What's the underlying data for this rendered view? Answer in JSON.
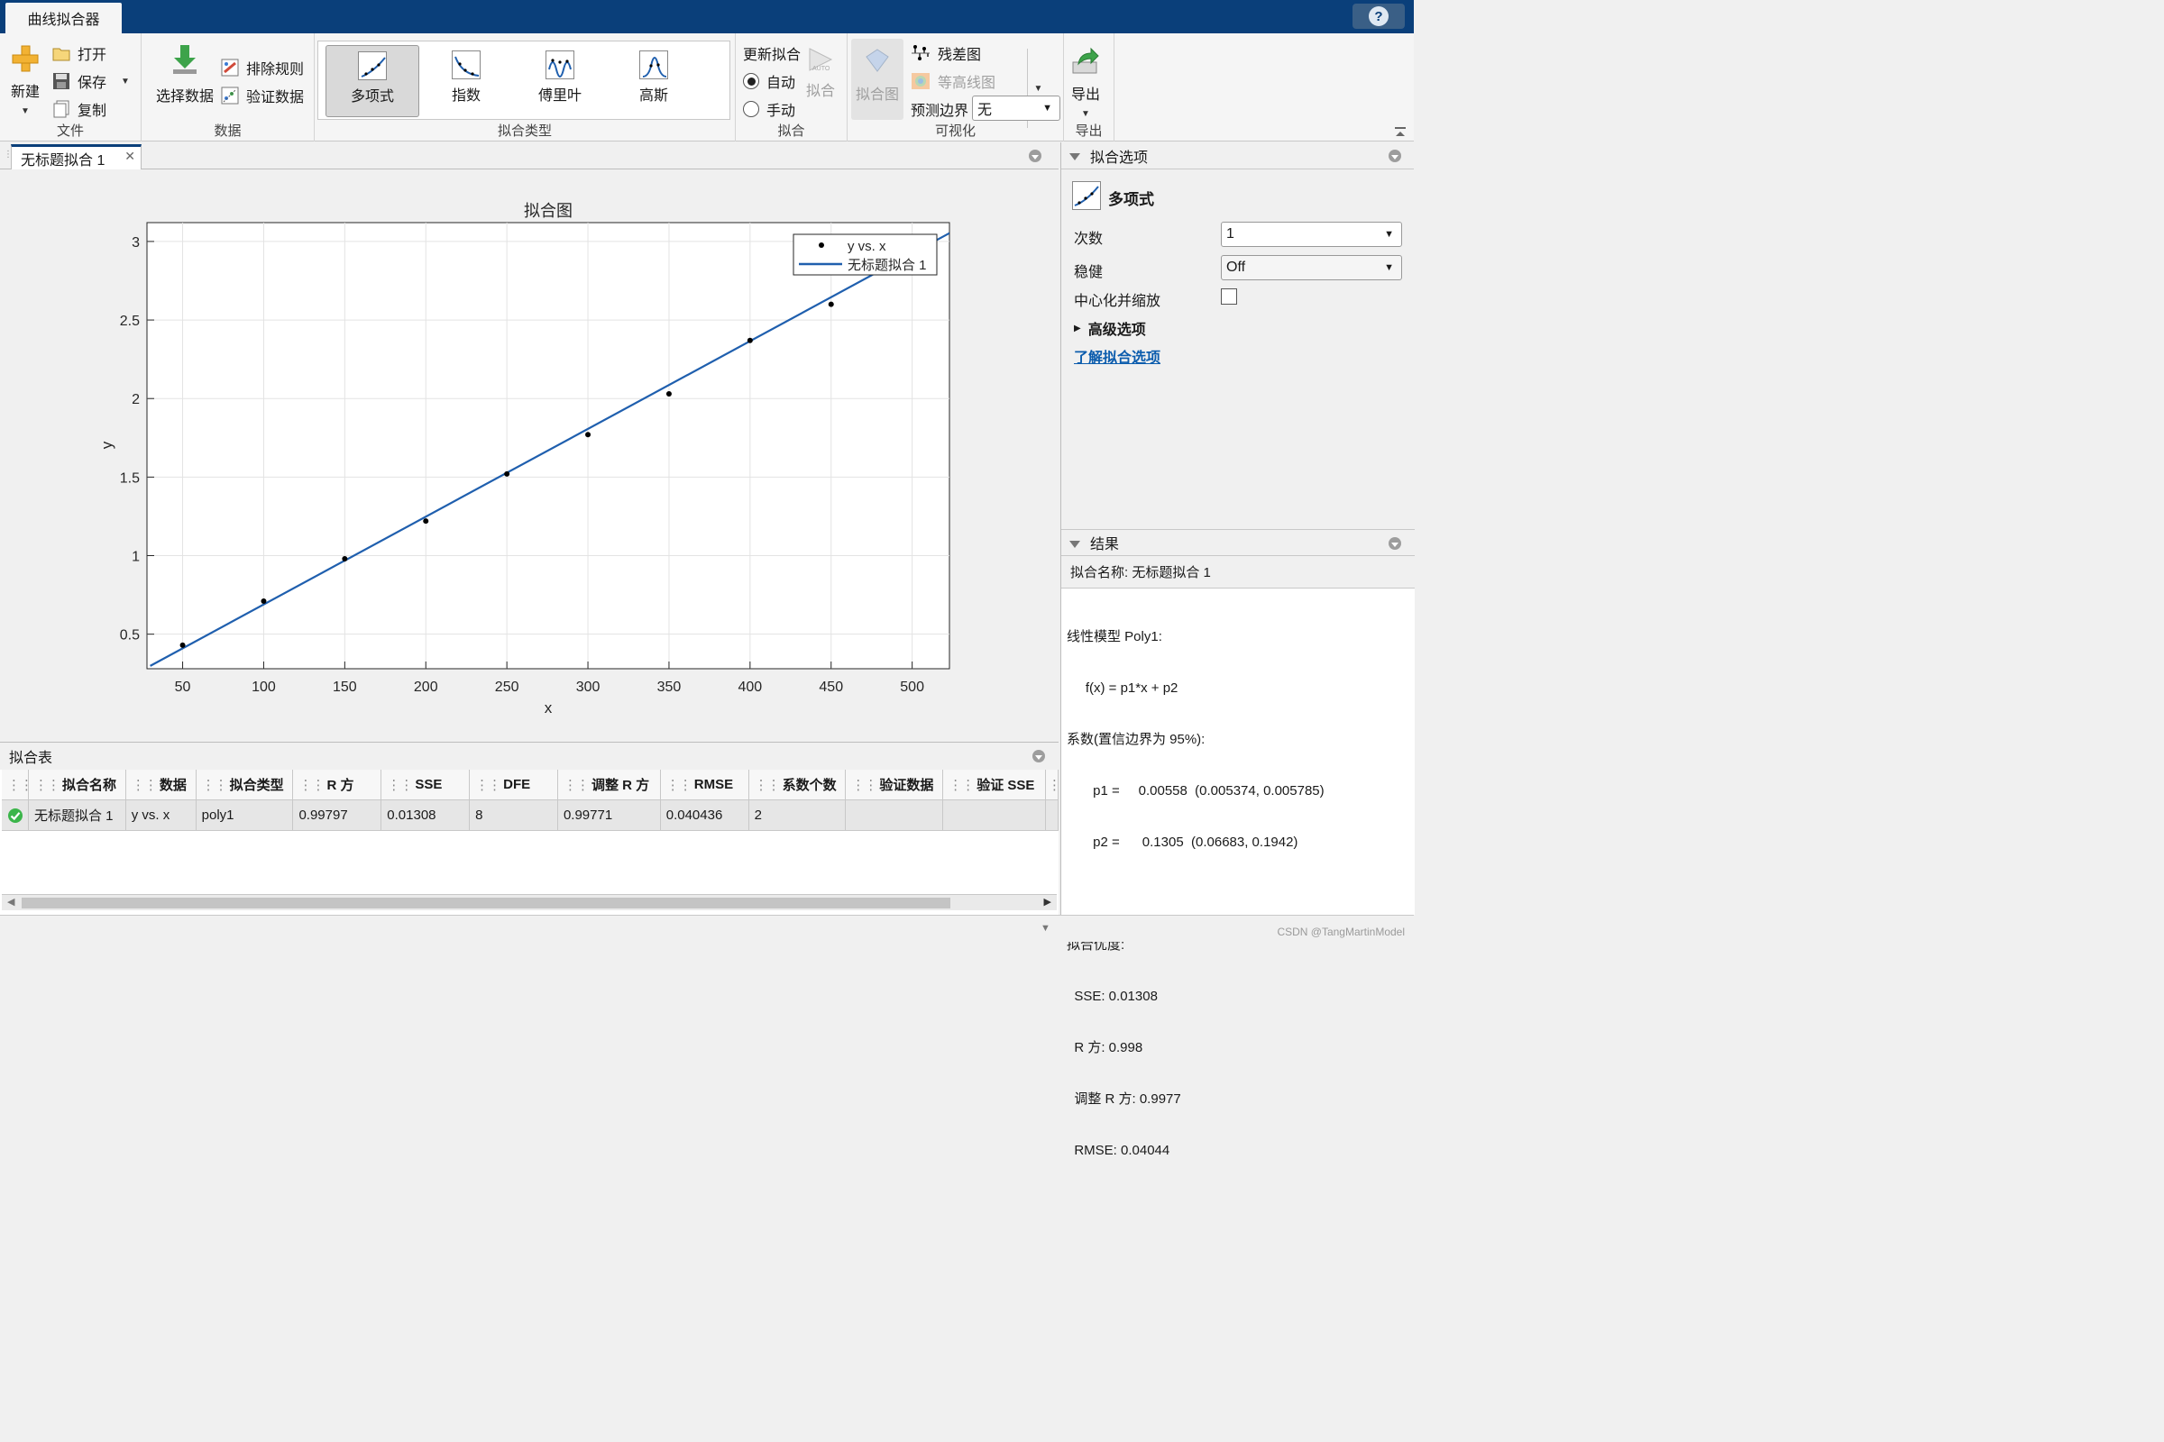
{
  "app_tab": "曲线拟合器",
  "help": "?",
  "ribbon": {
    "file": {
      "label": "文件",
      "new": "新建",
      "open": "打开",
      "save": "保存",
      "copy": "复制"
    },
    "data": {
      "label": "数据",
      "select_data": "选择数据",
      "exclusion_rules": "排除规则",
      "validation_data": "验证数据"
    },
    "fit_type": {
      "label": "拟合类型",
      "items": [
        "多项式",
        "指数",
        "傅里叶",
        "高斯"
      ],
      "selected": "多项式"
    },
    "fit": {
      "label": "拟合",
      "update_fit": "更新拟合",
      "auto": "自动",
      "manual": "手动",
      "fit_button": "拟合",
      "auto_selected": true
    },
    "visualization": {
      "label": "可视化",
      "fit_plot": "拟合图",
      "residuals": "残差图",
      "contour": "等高线图",
      "prediction_bounds_label": "预测边界",
      "prediction_bounds_value": "无"
    },
    "export": {
      "label": "导出",
      "export": "导出"
    }
  },
  "doc_tab": "无标题拟合 1",
  "chart_data": {
    "type": "scatter",
    "title": "拟合图",
    "xlabel": "x",
    "ylabel": "y",
    "xlim": [
      28,
      523
    ],
    "ylim": [
      0.28,
      3.12
    ],
    "xticks": [
      50,
      100,
      150,
      200,
      250,
      300,
      350,
      400,
      450,
      500
    ],
    "yticks": [
      0.5,
      1,
      1.5,
      2,
      2.5,
      3
    ],
    "ytick_labels": [
      "0.5",
      "1",
      "1.5",
      "2",
      "2.5",
      "3"
    ],
    "grid": true,
    "legend_position": "top-right",
    "series": [
      {
        "name": "y vs. x",
        "kind": "points",
        "color": "#000000",
        "x": [
          50,
          100,
          150,
          200,
          250,
          300,
          350,
          400,
          450
        ],
        "y": [
          0.43,
          0.71,
          0.98,
          1.22,
          1.52,
          1.77,
          2.03,
          2.37,
          2.6
        ]
      },
      {
        "name": "无标题拟合 1",
        "kind": "line",
        "color": "#1f5fae",
        "x": [
          30,
          523
        ],
        "y": [
          0.298,
          3.053
        ]
      }
    ]
  },
  "fit_table": {
    "title": "拟合表",
    "columns": [
      "拟合名称",
      "数据",
      "拟合类型",
      "R 方",
      "SSE",
      "DFE",
      "调整 R 方",
      "RMSE",
      "系数个数",
      "验证数据",
      "验证 SSE"
    ],
    "rows": [
      [
        "无标题拟合 1",
        "y vs. x",
        "poly1",
        "0.99797",
        "0.01308",
        "8",
        "0.99771",
        "0.040436",
        "2",
        "",
        ""
      ]
    ]
  },
  "fit_options": {
    "title": "拟合选项",
    "model": "多项式",
    "degree_label": "次数",
    "degree_value": "1",
    "robust_label": "稳健",
    "robust_value": "Off",
    "center_scale_label": "中心化并缩放",
    "center_scale_checked": false,
    "advanced": "高级选项",
    "learn_link": "了解拟合选项"
  },
  "results": {
    "title": "结果",
    "fit_name": "拟合名称: 无标题拟合 1",
    "lines": [
      "线性模型 Poly1:",
      "     f(x) = p1*x + p2",
      "系数(置信边界为 95%):",
      "       p1 =     0.00558  (0.005374, 0.005785)",
      "       p2 =      0.1305  (0.06683, 0.1942)",
      "",
      "拟合优度:",
      "  SSE: 0.01308",
      "  R 方: 0.998",
      "  调整 R 方: 0.9977",
      "  RMSE: 0.04044"
    ]
  },
  "watermark": "CSDN @TangMartinModel",
  "colors": {
    "title_bar": "#0a3f7a",
    "fit_line": "#1f5fae",
    "link": "#0b5cad",
    "status_ok": "#3bb54a"
  }
}
